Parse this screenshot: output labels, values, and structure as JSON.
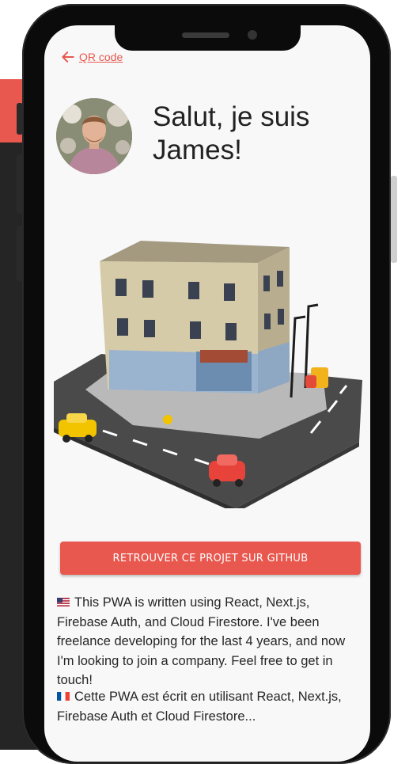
{
  "nav": {
    "back_label": "QR code"
  },
  "profile": {
    "greeting": "Salut, je suis James!"
  },
  "actions": {
    "github_label": "RETROUVER CE PROJET SUR GITHUB"
  },
  "content": {
    "paragraph_en": "This PWA is written using React, Next.js, Firebase Auth, and Cloud Firestore. I've been freelance developing for the last 4 years, and now I'm looking to join a company. Feel free to get in touch!",
    "paragraph_fr": "Cette PWA est écrit en utilisant React, Next.js, Firebase Auth et Cloud Firestore..."
  },
  "colors": {
    "accent": "#e8584f",
    "text": "#262626",
    "screen_bg": "#f8f8f8"
  },
  "icons": {
    "back": "arrow-left-icon",
    "flag_en": "us-flag-icon",
    "flag_fr": "fr-flag-icon"
  }
}
